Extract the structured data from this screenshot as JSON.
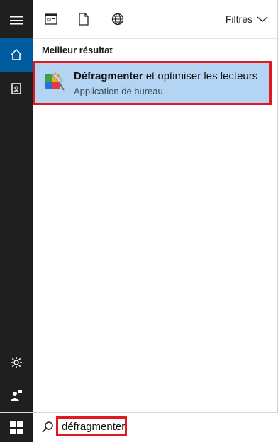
{
  "toolbar": {
    "filters_label": "Filtres"
  },
  "rail": {
    "items": [
      {
        "icon": "hamburger-menu-icon"
      },
      {
        "icon": "home-icon",
        "active": true
      },
      {
        "icon": "notebook-icon"
      },
      {
        "icon": "settings-gear-icon"
      },
      {
        "icon": "feedback-person-icon"
      }
    ]
  },
  "results": {
    "section_title": "Meilleur résultat",
    "best": {
      "title_bold": "Défragmenter",
      "title_rest": " et optimiser les lecteurs",
      "subtitle": "Application de bureau",
      "icon": "defragment-app-icon"
    }
  },
  "search": {
    "value": "défragmenter"
  },
  "colors": {
    "accent_blue": "#005a9e",
    "selection": "#b3d5f3",
    "highlight_red": "#e0181f",
    "rail_dark": "#1f1f1f"
  }
}
